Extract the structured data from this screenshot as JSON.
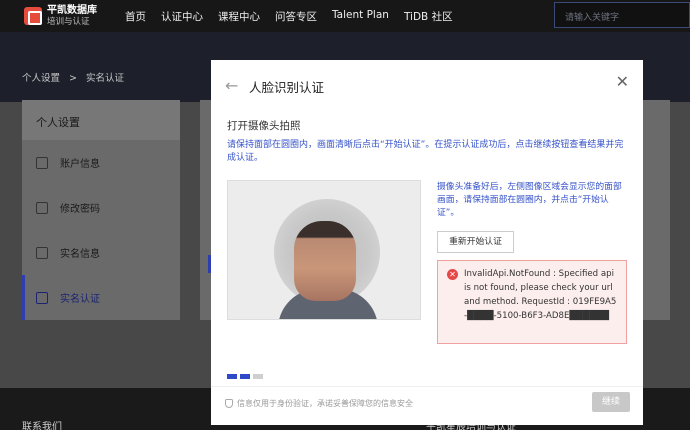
{
  "header": {
    "logo_line1": "平凯数据库",
    "logo_line2": "培训与认证",
    "nav": [
      "首页",
      "认证中心",
      "课程中心",
      "问答专区",
      "Talent Plan",
      "TiDB 社区"
    ],
    "search_placeholder": "请输入关键字"
  },
  "breadcrumb": [
    "个人设置",
    ">",
    "实名认证"
  ],
  "sidebar": {
    "title": "个人设置",
    "items": [
      {
        "label": "账户信息",
        "icon": "list-icon"
      },
      {
        "label": "修改密码",
        "icon": "shield-check-icon"
      },
      {
        "label": "实名信息",
        "icon": "id-card-icon"
      },
      {
        "label": "实名认证",
        "icon": "id-card-icon",
        "active": true
      }
    ]
  },
  "footer": {
    "left": "联系我们",
    "right": "平凯星辰培训与认证"
  },
  "modal": {
    "title": "人脸识别认证",
    "subtitle": "打开摄像头拍照",
    "hint": "请保持面部在圆圈内，画面清晰后点击“开始认证”。在提示认证成功后，点击继续按钮查看结果并完成认证。",
    "camera_text": "摄像头准备好后，左侧图像区域会显示您的面部画面，请保持面部在圆圈内，并点击“开始认证”。",
    "restart_label": "重新开始认证",
    "error_text": "InvalidApi.NotFound : Specified api is not found, please check your url and method. RequestId : 019FE9A5-████-5100-B6F3-AD8E██████",
    "progress_steps": 3,
    "progress_current": 2,
    "privacy": "信息仅用于身份验证，承诺妥善保障您的信息安全",
    "continue_label": "继续"
  },
  "colors": {
    "accent": "#2f49c8",
    "error": "#e54848",
    "hint": "#3552c9"
  }
}
